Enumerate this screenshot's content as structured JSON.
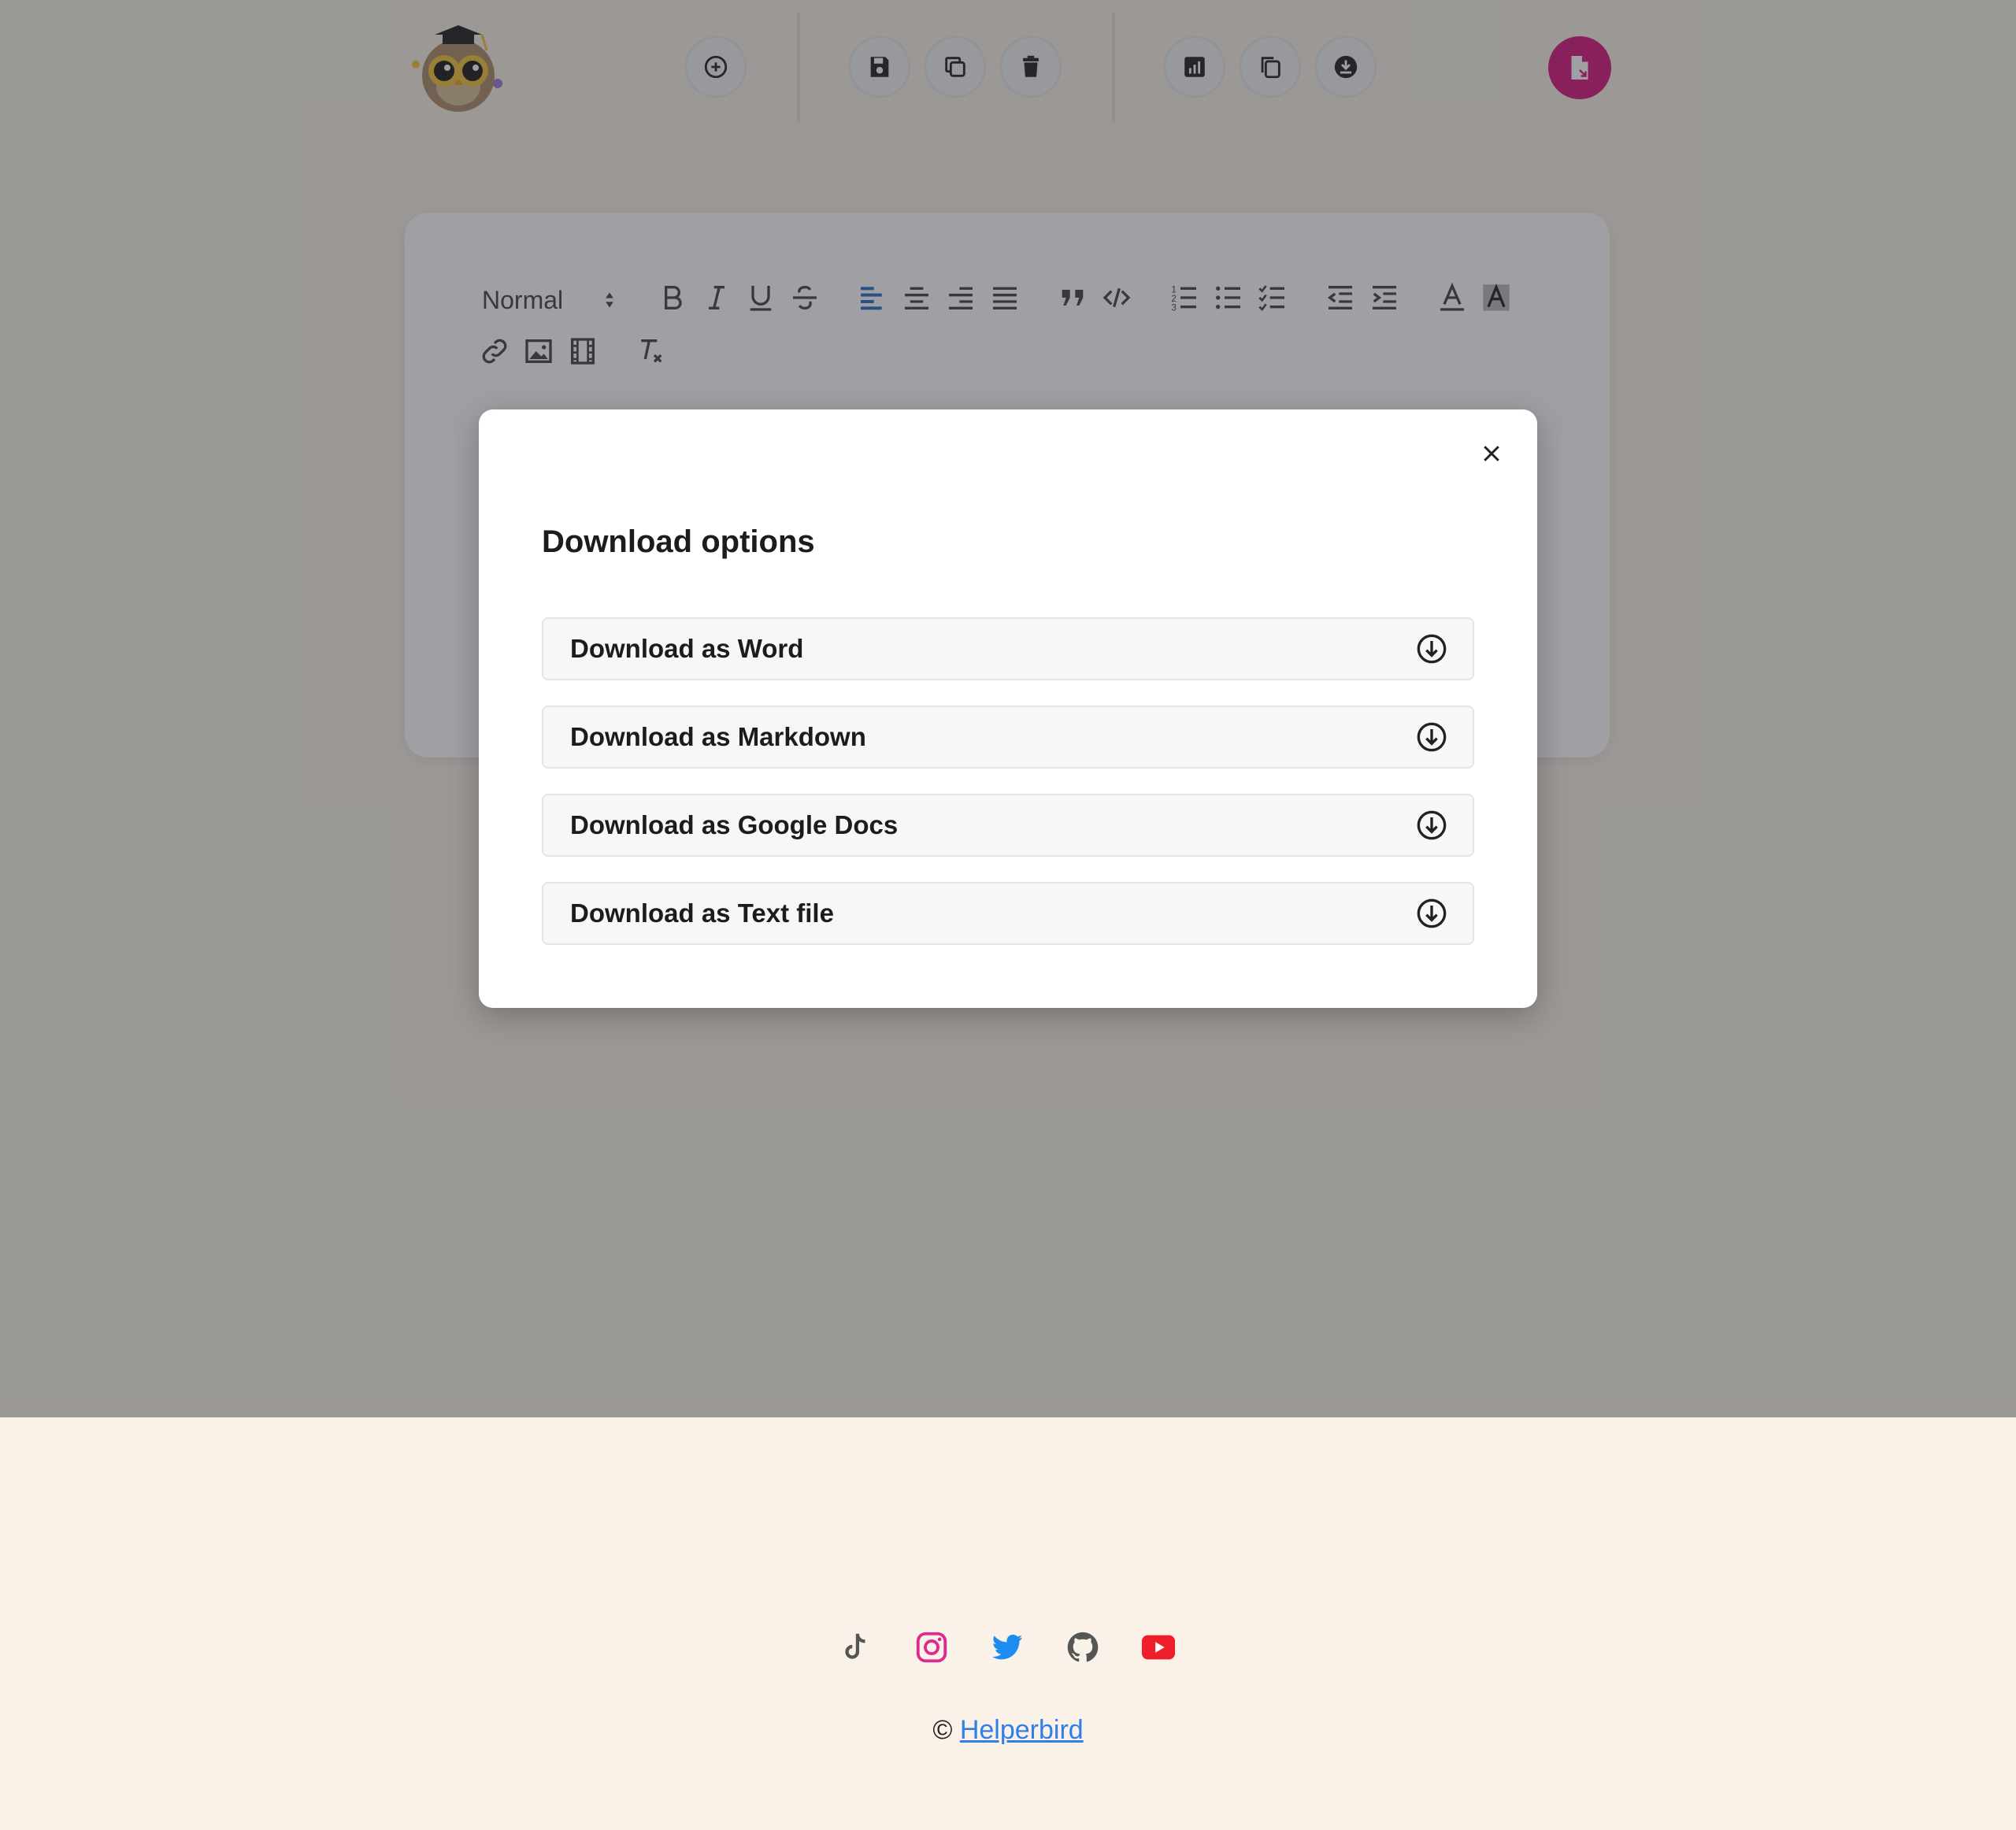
{
  "topbar": {
    "logo_icon": "helperbird-owl-logo",
    "buttons": [
      {
        "name": "new-note-button",
        "icon": "plus-circle-icon"
      },
      {
        "name": "save-button",
        "icon": "save-icon"
      },
      {
        "name": "duplicate-button",
        "icon": "copy-icon"
      },
      {
        "name": "delete-button",
        "icon": "trash-icon"
      },
      {
        "name": "stats-button",
        "icon": "chart-icon"
      },
      {
        "name": "copy-to-clipboard-button",
        "icon": "clipboard-copy-icon"
      },
      {
        "name": "download-button",
        "icon": "download-icon"
      },
      {
        "name": "export-button",
        "icon": "file-export-icon"
      }
    ],
    "accent_color": "#d8177f"
  },
  "editor": {
    "format_select": "Normal"
  },
  "modal": {
    "title": "Download options",
    "options": [
      {
        "label": "Download as Word"
      },
      {
        "label": "Download as Markdown"
      },
      {
        "label": "Download as Google Docs"
      },
      {
        "label": "Download as Text file"
      }
    ]
  },
  "footer": {
    "social": [
      {
        "name": "tiktok",
        "color": "#555555"
      },
      {
        "name": "instagram",
        "color": "#e0288e"
      },
      {
        "name": "twitter",
        "color": "#1d8cf0"
      },
      {
        "name": "github",
        "color": "#555555"
      },
      {
        "name": "youtube",
        "color": "#ee1f2a"
      }
    ],
    "copyright_symbol": "©",
    "brand_link": "Helperbird"
  }
}
